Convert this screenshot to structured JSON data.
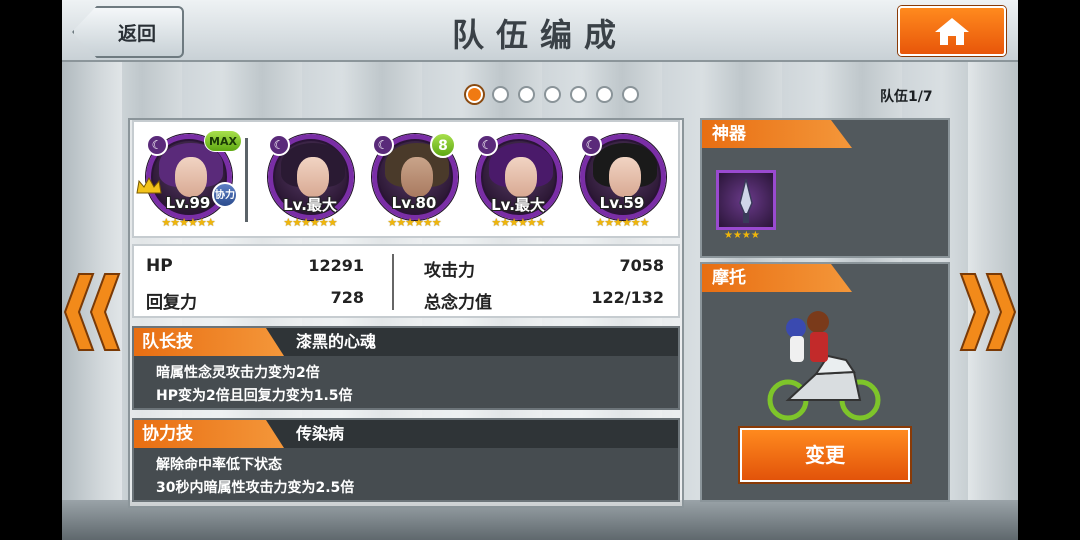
{
  "header": {
    "back_label": "返回",
    "title": "队伍编成"
  },
  "pagination": {
    "total_dots": 7,
    "active_index": 0,
    "team_index": "队伍1/7"
  },
  "team": {
    "members": [
      {
        "level": "Lv.99",
        "stars": "★★★★★★",
        "badge": "MAX",
        "leader": true,
        "assist": "协力"
      },
      {
        "level": "Lv.最大",
        "stars": "★★★★★★"
      },
      {
        "level": "Lv.80",
        "stars": "★★★★★★",
        "badge": "8"
      },
      {
        "level": "Lv.最大",
        "stars": "★★★★★★"
      },
      {
        "level": "Lv.59",
        "stars": "★★★★★★"
      }
    ]
  },
  "stats": {
    "hp_label": "HP",
    "hp_value": "12291",
    "recover_label": "回复力",
    "recover_value": "728",
    "attack_label": "攻击力",
    "attack_value": "7058",
    "spirit_label": "总念力值",
    "spirit_value": "122/132"
  },
  "leader_skill": {
    "tag": "队长技",
    "name": "漆黑的心魂",
    "lines": [
      "暗属性念灵攻击力变为2倍",
      "HP变为2倍且回复力变为1.5倍"
    ]
  },
  "assist_skill": {
    "tag": "协力技",
    "name": "传染病",
    "lines": [
      "解除命中率低下状态",
      "30秒内暗属性攻击力变为2.5倍"
    ]
  },
  "artifact": {
    "tag": "神器",
    "stars": "★★★★"
  },
  "motorbike": {
    "tag": "摩托",
    "change_label": "变更"
  },
  "colors": {
    "accent_orange": "#e86e12",
    "active_dot": "#f07a12",
    "badge_green": "#7ec52a",
    "frame_purple": "#7a2ea6"
  }
}
